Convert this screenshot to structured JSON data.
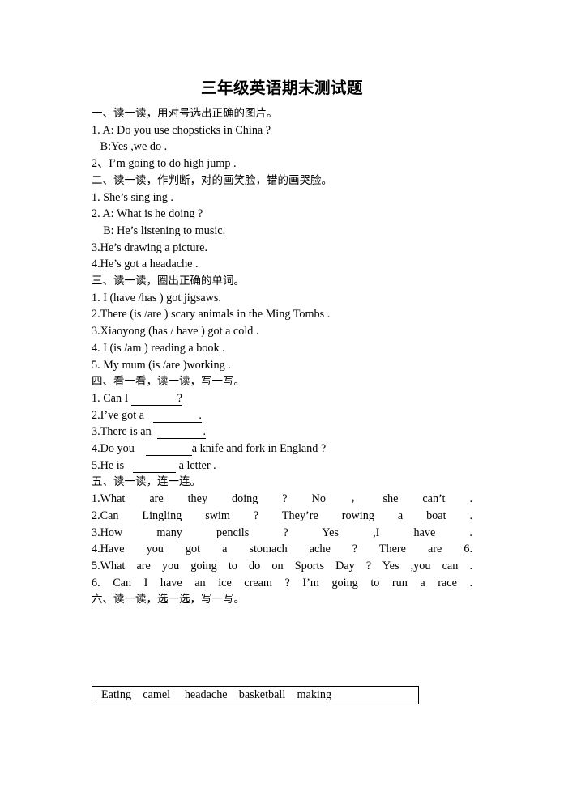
{
  "document": {
    "title": "三年级英语期末测试题"
  },
  "sections": [
    {
      "heading": "一、读一读，用对号选出正确的图片。",
      "items": [
        "1. A: Do you use chopsticks in China ?",
        "   B:Yes ,we do .",
        "2、I’m going to do high jump ."
      ]
    },
    {
      "heading": "二、读一读，作判断，对的画笑脸，错的画哭脸。",
      "items": [
        "1. She’s sing ing .",
        "2. A: What is he doing ?",
        "    B: He’s listening to music.",
        "3.He’s drawing a picture.",
        "4.He’s got a headache ."
      ]
    },
    {
      "heading": "三、读一读，圈出正确的单词。",
      "items": [
        "1. I (have /has ) got jigsaws.",
        "2.There (is /are ) scary animals in the Ming Tombs .",
        "3.Xiaoyong (has / have ) got a cold .",
        "4. I (is /am ) reading a book .",
        "5. My mum (is /are )working ."
      ]
    },
    {
      "heading": "四、看一看，读一读，写一写。",
      "fill_items": [
        {
          "prefix": "1. Can I ",
          "blank": "                ?",
          "suffix": ""
        },
        {
          "prefix": "2.I’ve got a   ",
          "blank": "                .",
          "suffix": ""
        },
        {
          "prefix": "3.There is an  ",
          "blank": "                .",
          "suffix": ""
        },
        {
          "prefix": "4.Do you    ",
          "blank": "                ",
          "suffix": "a knife and fork in England ?"
        },
        {
          "prefix": "5.He is   ",
          "blank": "               ",
          "suffix": " a letter ."
        }
      ]
    },
    {
      "heading": "五、读一读，连一连。",
      "match_items": [
        {
          "question": "1.What are they doing ?",
          "answer": "No ，she can’t ."
        },
        {
          "question": "2.Can Lingling swim ?",
          "answer": "They’re rowing a boat ."
        },
        {
          "question": "3.How many pencils ?",
          "answer": "Yes ,I have ."
        },
        {
          "question": "4.Have you got a stomach ache ?",
          "answer": "There are 6."
        },
        {
          "question": "5.What are you going to do on Sports Day ?",
          "answer": "Yes ,you can ."
        },
        {
          "question": "6. Can I have an ice cream ?",
          "answer": "I’m going to run a race ."
        }
      ]
    },
    {
      "heading": "六、读一读，选一选，写一写。",
      "word_bank": "Eating    camel     headache    basketball    making"
    }
  ]
}
